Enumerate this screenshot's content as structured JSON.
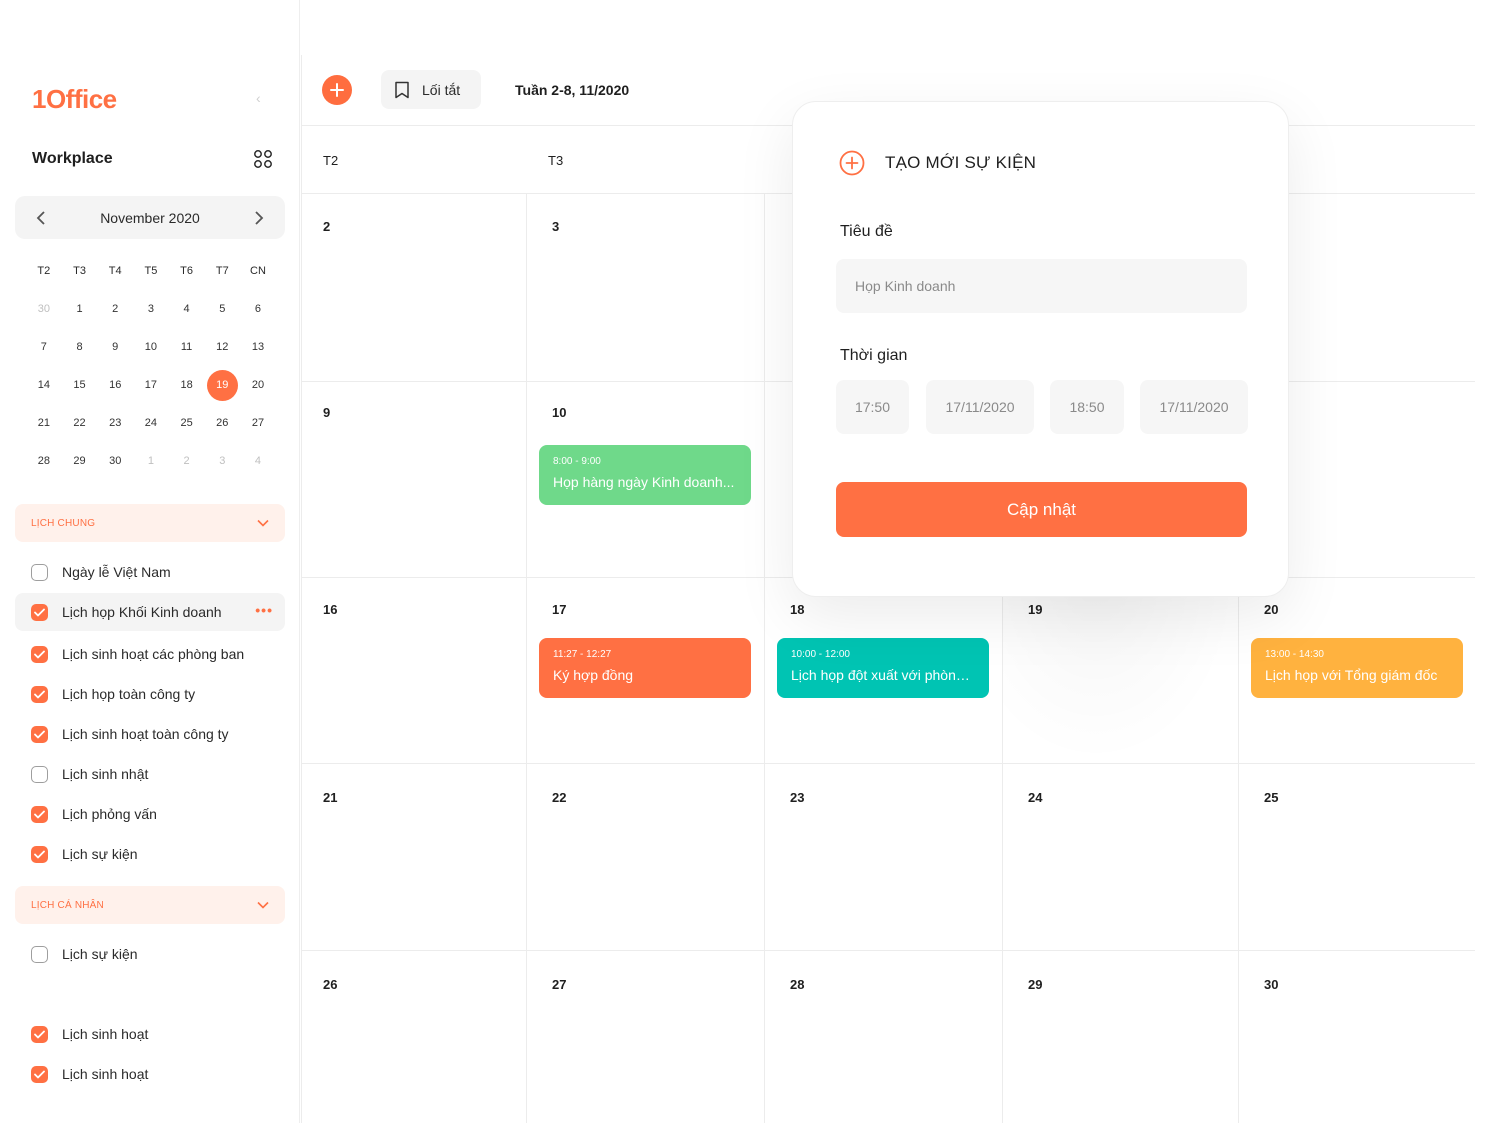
{
  "sidebar": {
    "logo": "1Office",
    "collapse_icon": "chevron-left-icon",
    "workspace_title": "Workplace",
    "apps_icon": "grid-apps-icon",
    "month_label": "November 2020",
    "weekdays": [
      "T2",
      "T3",
      "T4",
      "T5",
      "T6",
      "T7",
      "CN"
    ],
    "weeks": [
      [
        "30",
        "1",
        "2",
        "3",
        "4",
        "5",
        "6"
      ],
      [
        "7",
        "8",
        "9",
        "10",
        "11",
        "12",
        "13"
      ],
      [
        "14",
        "15",
        "16",
        "17",
        "18",
        "19",
        "20"
      ],
      [
        "21",
        "22",
        "23",
        "24",
        "25",
        "26",
        "27"
      ],
      [
        "28",
        "29",
        "30",
        "1",
        "2",
        "3",
        "4"
      ]
    ],
    "today": "19",
    "shared_section": "LỊCH CHUNG",
    "shared_calendars": [
      {
        "label": "Ngày lễ Việt Nam",
        "checked": false
      },
      {
        "label": "Lịch họp Khối Kinh doanh",
        "checked": true
      },
      {
        "label": "Lịch sinh hoạt các phòng ban",
        "checked": true
      },
      {
        "label": "Lịch họp toàn công ty",
        "checked": true
      },
      {
        "label": "Lịch sinh hoạt toàn công ty",
        "checked": true
      },
      {
        "label": "Lịch sinh nhật",
        "checked": false
      },
      {
        "label": "Lịch phỏng vấn",
        "checked": true
      },
      {
        "label": "Lịch sự kiện",
        "checked": true
      }
    ],
    "more_label": "•••",
    "personal_section": "LỊCH CÁ NHÂN",
    "personal_calendars": [
      {
        "label": "Lịch sự kiện",
        "checked": false
      },
      {
        "label": "Lịch sinh hoạt",
        "checked": true
      },
      {
        "label": "Lịch sinh hoạt",
        "checked": true
      }
    ]
  },
  "toolbar": {
    "add_icon": "plus-icon",
    "shortcut_label": "Lối tắt",
    "shortcut_icon": "bookmark-icon",
    "week_label": "Tuần 2-8, 11/2020"
  },
  "calendar": {
    "day_headers": [
      "T2",
      "T3",
      "",
      "",
      ""
    ],
    "rows": [
      [
        "2",
        "3",
        "",
        "",
        ""
      ],
      [
        "9",
        "10",
        "",
        "",
        ""
      ],
      [
        "16",
        "17",
        "18",
        "19",
        "20"
      ],
      [
        "21",
        "22",
        "23",
        "24",
        "25"
      ],
      [
        "26",
        "27",
        "28",
        "29",
        "30"
      ]
    ],
    "events": [
      {
        "row": 1,
        "col": 1,
        "time": "8:00 - 9:00",
        "title": "Họp hàng ngày Kinh doanh...",
        "color": "#6fd98a"
      },
      {
        "row": 2,
        "col": 1,
        "time": "11:27 - 12:27",
        "title": "Ký hợp đồng",
        "color": "#ff7043"
      },
      {
        "row": 2,
        "col": 2,
        "time": "10:00 - 12:00",
        "title": "Lịch họp đột xuất với phòng...",
        "color": "#00c4b3"
      },
      {
        "row": 2,
        "col": 4,
        "time": "13:00 - 14:30",
        "title": "Lịch họp với Tổng giám đốc",
        "color": "#ffb23f"
      }
    ]
  },
  "popup": {
    "title_icon": "plus-circle-icon",
    "title": "TẠO MỚI SỰ KIỆN",
    "title_label": "Tiêu đề",
    "title_placeholder": "Họp Kinh doanh",
    "time_label": "Thời gian",
    "start_time": "17:50",
    "start_date": "17/11/2020",
    "end_time": "18:50",
    "end_date": "17/11/2020",
    "submit_label": "Cập nhật"
  },
  "colors": {
    "accent": "#ff7043",
    "accent_soft": "#fff1eb",
    "grid_line": "#ececec"
  }
}
